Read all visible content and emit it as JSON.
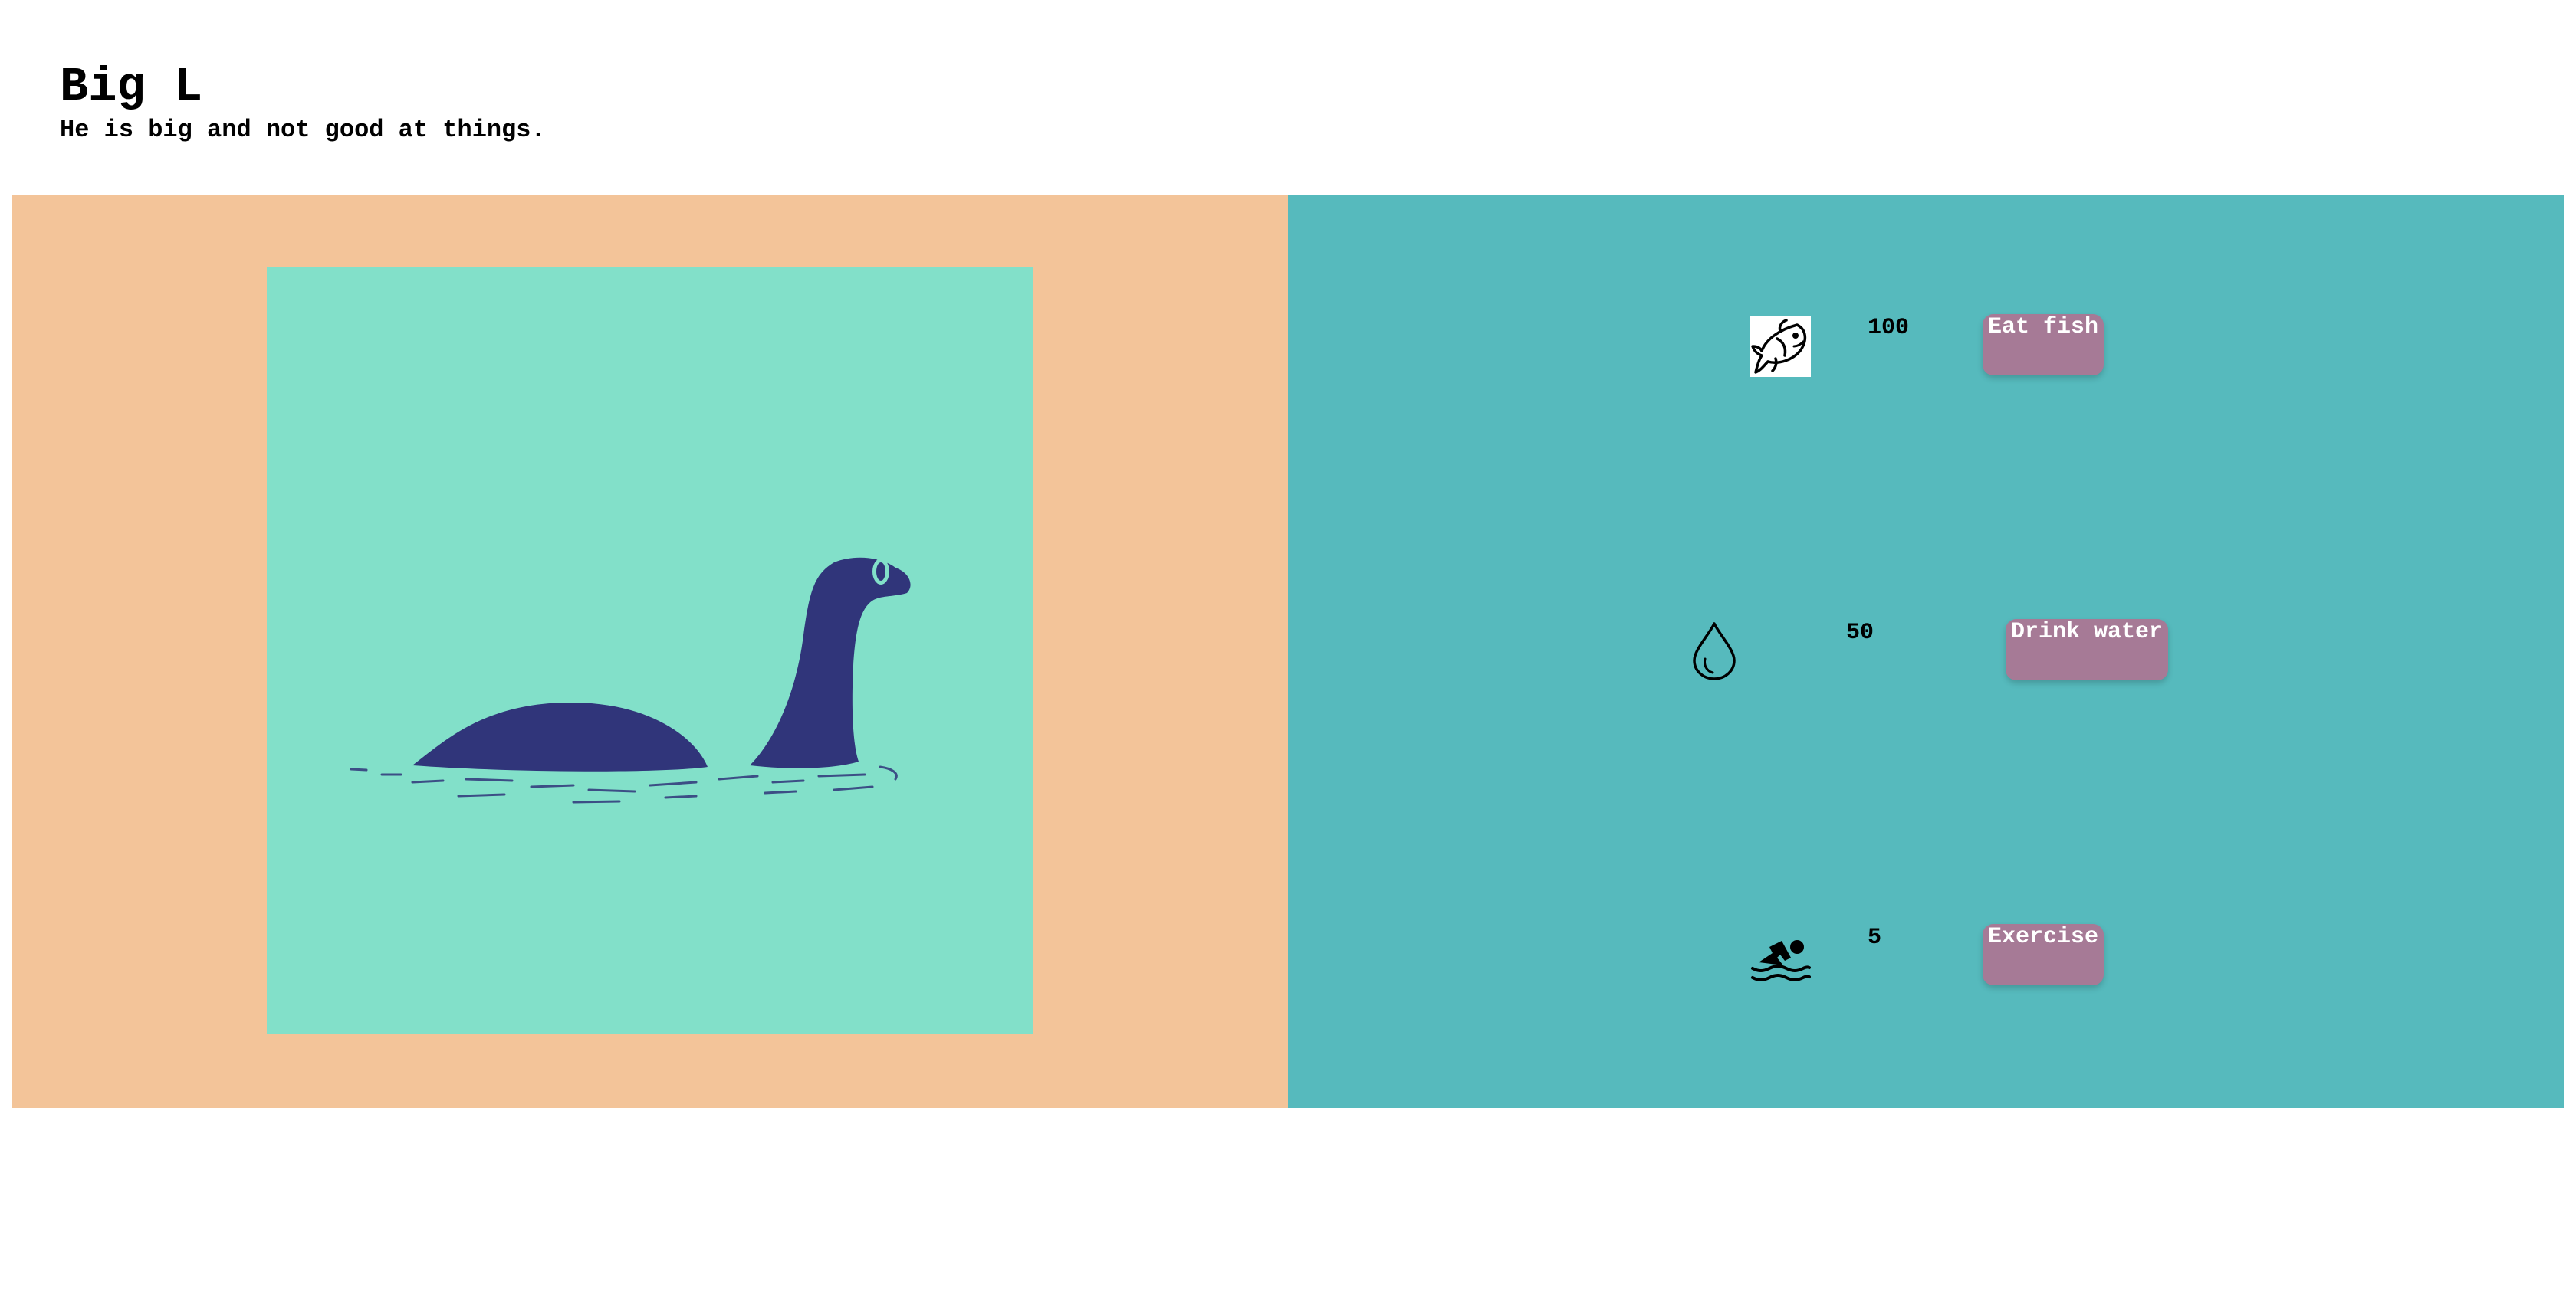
{
  "header": {
    "title": "Big L",
    "subtitle": "He is big and not good at things."
  },
  "pet": {
    "image": "loch-ness-monster-silhouette",
    "colors": {
      "frame_bg": "#82e0c9",
      "silhouette": "#30357a"
    }
  },
  "stats": [
    {
      "icon": "fish-icon",
      "value": "100",
      "action_label": "Eat fish"
    },
    {
      "icon": "water-drop-icon",
      "value": "50",
      "action_label": "Drink water"
    },
    {
      "icon": "swimmer-icon",
      "value": "5",
      "action_label": "Exercise"
    }
  ],
  "colors": {
    "left_panel": "#f3c499",
    "right_panel": "#56babd",
    "button": "#a67a96",
    "button_text": "#ffffff"
  }
}
